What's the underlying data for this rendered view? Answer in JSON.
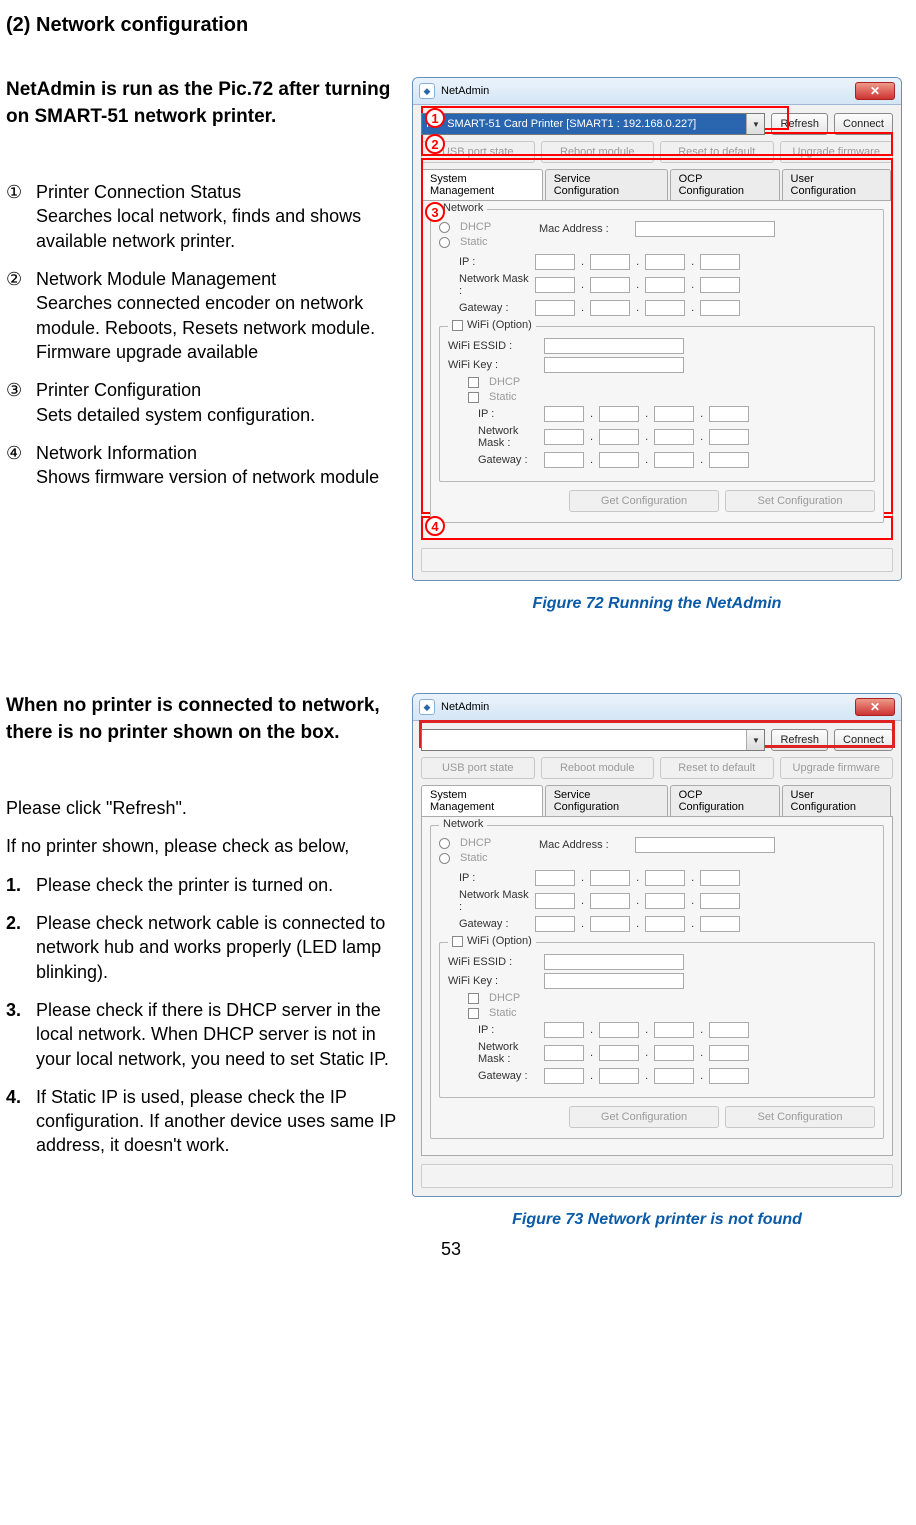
{
  "section_header": "(2) Network configuration",
  "block1": {
    "intro": "NetAdmin is run as the Pic.72 after turning on SMART-51 network printer.",
    "items": [
      {
        "num": "①",
        "title": "Printer Connection Status",
        "desc": "Searches local network, finds and shows available network printer."
      },
      {
        "num": "②",
        "title": "Network Module Management",
        "desc": "Searches connected encoder on network module. Reboots, Resets network module. Firmware upgrade available"
      },
      {
        "num": "③",
        "title": "Printer Configuration",
        "desc": "Sets detailed system configuration."
      },
      {
        "num": "④",
        "title": "Network Information",
        "desc": "Shows firmware version of network module"
      }
    ],
    "caption": "Figure 72 Running the NetAdmin"
  },
  "block2": {
    "intro": "When no printer is connected to network, there is no printer shown on the box.",
    "pre1": "Please click \"Refresh\".",
    "pre2": "If no printer shown, please check as below,",
    "items": [
      {
        "num": "1.",
        "desc": "Please check the printer is turned on."
      },
      {
        "num": "2.",
        "desc": "Please check network cable is connected to network hub and works properly (LED lamp blinking)."
      },
      {
        "num": "3.",
        "desc": "Please check if there is DHCP server in the local network. When DHCP server is not in your local network, you need to set Static IP."
      },
      {
        "num": "4.",
        "desc": "If Static IP is used, please check the IP configuration. If another device uses same IP address, it doesn't work."
      }
    ],
    "caption": "Figure 73 Network printer is not found"
  },
  "win": {
    "title": "NetAdmin",
    "printer_select_a": "IDP SMART-51 Card Printer  [SMART1 : 192.168.0.227]",
    "printer_select_b": "",
    "refresh": "Refresh",
    "connect": "Connect",
    "usb_state": "USB port state",
    "reboot": "Reboot module",
    "reset": "Reset to default",
    "upgrade": "Upgrade firmware",
    "tabs": [
      "System Management",
      "Service Configuration",
      "OCP Configuration",
      "User Configuration"
    ],
    "group_network": "Network",
    "dhcp": "DHCP",
    "static": "Static",
    "mac": "Mac Address :",
    "ip": "IP :",
    "mask": "Network Mask :",
    "gw": "Gateway :",
    "wifi_group": "WiFi (Option)",
    "wifi_essid": "WiFi ESSID :",
    "wifi_key": "WiFi Key :",
    "get_cfg": "Get Configuration",
    "set_cfg": "Set Configuration",
    "ann": {
      "n1": "1",
      "n2": "2",
      "n3": "3",
      "n4": "4"
    }
  },
  "page_number": "53"
}
